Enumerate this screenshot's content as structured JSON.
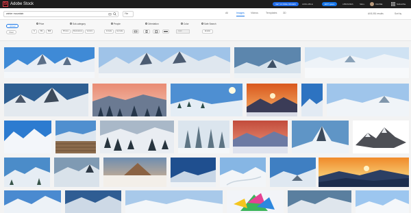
{
  "topbar": {
    "logo_text": "St",
    "brand": "Adobe Stock",
    "cta_label": "GET 10 FREE IMAGES",
    "nav": [
      "AVAILABLE",
      "LIBRARIES",
      "SELL"
    ],
    "pill_label": "EDIT space",
    "user_name": "CHASE",
    "user_status": "Subscribe"
  },
  "search": {
    "query": "winter mountain",
    "file_filter": "File",
    "tabs": [
      "All",
      "Images",
      "Videos",
      "Templates",
      "3D"
    ],
    "active_tab": "Images",
    "right": [
      "All 8,051 results",
      "Sort by"
    ]
  },
  "filters": {
    "buttons": [
      "Upload",
      "Clear"
    ],
    "groups": [
      {
        "title": "Price",
        "chips": [
          "$",
          "$$",
          "$$$"
        ]
      },
      {
        "title": "Sub-category",
        "chips": [
          "Photos",
          "Illustrations",
          "Vectors"
        ]
      },
      {
        "title": "People",
        "chips": [
          "Include",
          "Exclude"
        ]
      },
      {
        "title": "Orientation",
        "chips": []
      },
      {
        "title": "Color",
        "chips": []
      },
      {
        "title": "Safe Search",
        "chips": [
          "Enable"
        ]
      }
    ],
    "color_placeholder": "Color"
  },
  "colors": {
    "accent": "#1473e6",
    "topbar": "#1e1e1e",
    "cta": "#1f6be8"
  },
  "icons": [
    "adobe-stock-logo-icon",
    "search-icon",
    "camera-icon",
    "bell-icon",
    "apps-grid-icon",
    "currency-icon",
    "category-icon",
    "people-icon",
    "orientation-icon",
    "color-icon",
    "safe-search-icon"
  ]
}
